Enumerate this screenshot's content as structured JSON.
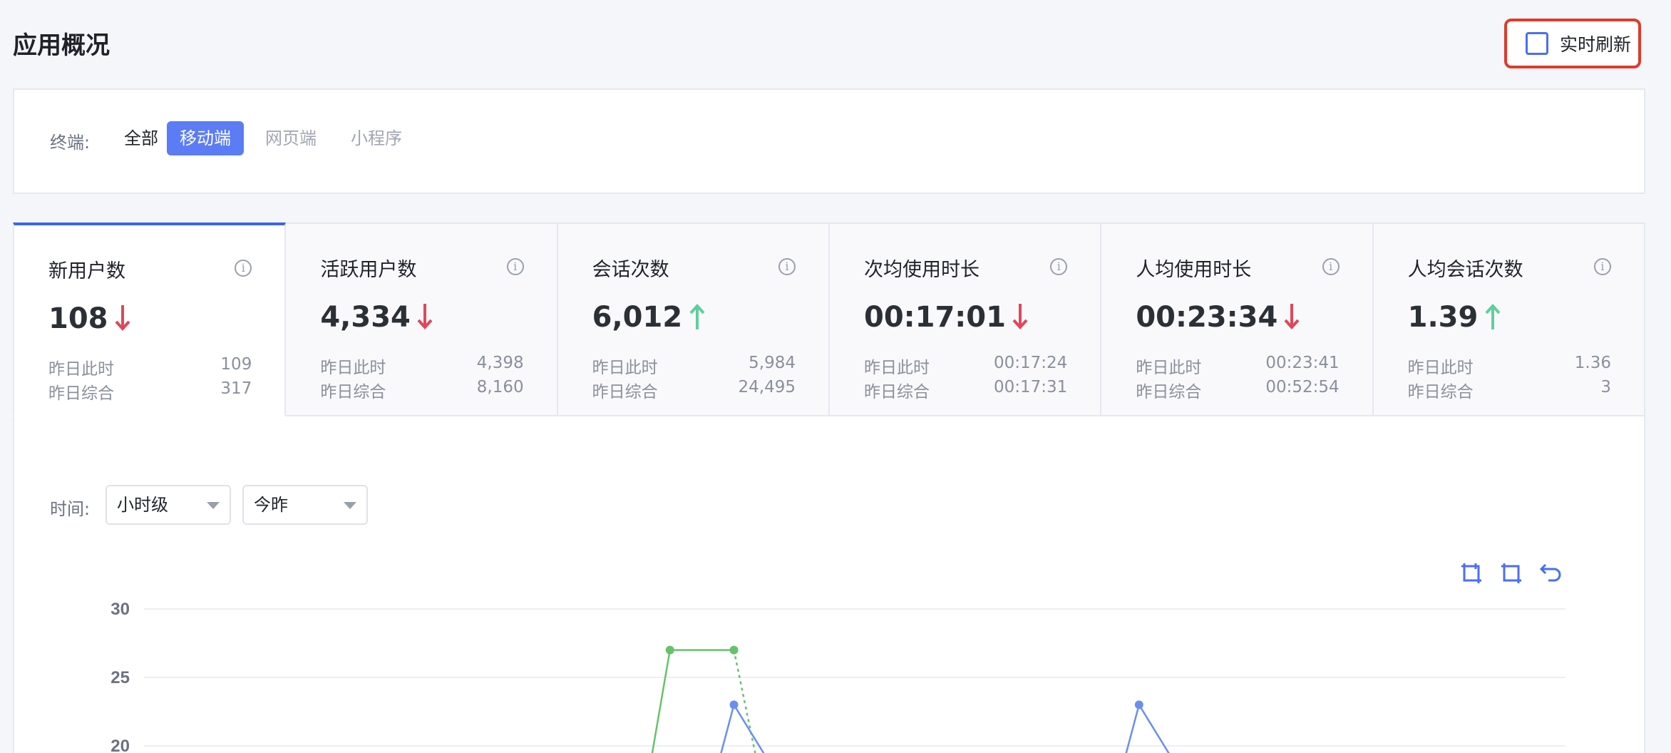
{
  "page": {
    "title": "应用概况"
  },
  "refresh": {
    "label": "实时刷新"
  },
  "filter": {
    "label": "终端:",
    "options": [
      "全部",
      "移动端",
      "网页端",
      "小程序"
    ],
    "selected": "移动端"
  },
  "stats": [
    {
      "name": "新用户数",
      "value": "108",
      "trend": "down",
      "yesterday_now_label": "昨日此时",
      "yesterday_now": "109",
      "yesterday_total_label": "昨日综合",
      "yesterday_total": "317"
    },
    {
      "name": "活跃用户数",
      "value": "4,334",
      "trend": "down",
      "yesterday_now_label": "昨日此时",
      "yesterday_now": "4,398",
      "yesterday_total_label": "昨日综合",
      "yesterday_total": "8,160"
    },
    {
      "name": "会话次数",
      "value": "6,012",
      "trend": "up",
      "yesterday_now_label": "昨日此时",
      "yesterday_now": "5,984",
      "yesterday_total_label": "昨日综合",
      "yesterday_total": "24,495"
    },
    {
      "name": "次均使用时长",
      "value": "00:17:01",
      "trend": "down",
      "yesterday_now_label": "昨日此时",
      "yesterday_now": "00:17:24",
      "yesterday_total_label": "昨日综合",
      "yesterday_total": "00:17:31"
    },
    {
      "name": "人均使用时长",
      "value": "00:23:34",
      "trend": "down",
      "yesterday_now_label": "昨日此时",
      "yesterday_now": "00:23:41",
      "yesterday_total_label": "昨日综合",
      "yesterday_total": "00:52:54"
    },
    {
      "name": "人均会话次数",
      "value": "1.39",
      "trend": "up",
      "yesterday_now_label": "昨日此时",
      "yesterday_now": "1.36",
      "yesterday_total_label": "昨日综合",
      "yesterday_total": "3"
    }
  ],
  "time_filter": {
    "label": "时间:",
    "granularity": "小时级",
    "range": "今昨"
  },
  "colors": {
    "accent": "#5b7cf5",
    "down": "#e0475b",
    "up": "#5fcf9c",
    "series_today": "#6a8ff0",
    "series_yesterday": "#66c26a"
  },
  "chart_data": {
    "type": "line",
    "y_ticks": [
      "30",
      "25",
      "20"
    ],
    "ylim": [
      20,
      30
    ],
    "series": [
      {
        "points": [
          {
            "x": 0.37,
            "y": 27
          },
          {
            "x": 0.415,
            "y": 27
          }
        ]
      },
      {
        "points": [
          {
            "x": 0.415,
            "y": 23
          },
          {
            "x": 0.7,
            "y": 23
          }
        ]
      }
    ]
  }
}
